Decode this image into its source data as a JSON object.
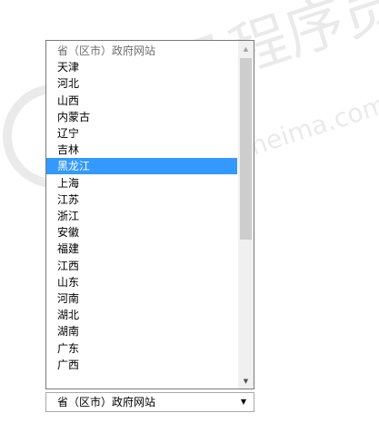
{
  "dropdown": {
    "placeholder": "省（区市）政府网站",
    "options": [
      "省（区市）政府网站",
      "天津",
      "河北",
      "山西",
      "内蒙古",
      "辽宁",
      "吉林",
      "黑龙江",
      "上海",
      "江苏",
      "浙江",
      "安徽",
      "福建",
      "江西",
      "山东",
      "河南",
      "湖北",
      "湖南",
      "广东",
      "广西"
    ],
    "highlighted_index": 7,
    "selected_value": "省（区市）政府网站"
  },
  "watermark": {
    "text_cn": "黑马程序员",
    "text_en": "www.itheima.com"
  },
  "icons": {
    "scroll_up": "triangle-up-icon",
    "scroll_down": "triangle-down-icon",
    "dropdown": "triangle-down-icon"
  },
  "colors": {
    "highlight": "#3399ff",
    "border": "#7a7a7a"
  }
}
